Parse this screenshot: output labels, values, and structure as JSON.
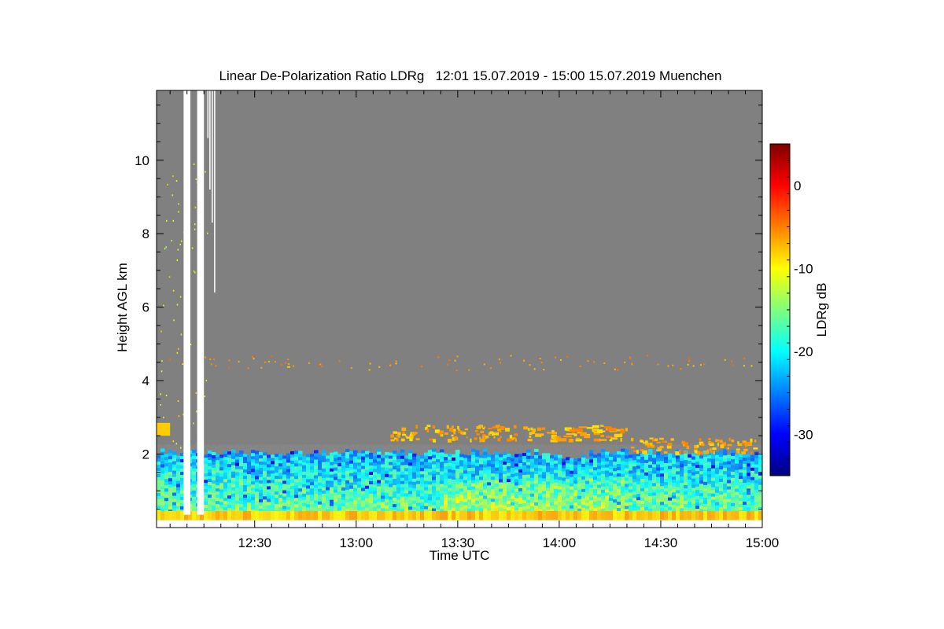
{
  "chart_data": {
    "type": "heatmap",
    "title": "Linear De-Polarization Ratio LDRg   12:01 15.07.2019 - 15:00 15.07.2019 Muenchen",
    "xlabel": "Time UTC",
    "ylabel": "Height AGL km",
    "colorbar_label": "LDRg dB",
    "x_range": [
      "12:01",
      "15:00"
    ],
    "xlim_minutes_utc": [
      721,
      900
    ],
    "x_ticks": [
      {
        "label": "12:30",
        "minutes": 750
      },
      {
        "label": "13:00",
        "minutes": 780
      },
      {
        "label": "13:30",
        "minutes": 810
      },
      {
        "label": "14:00",
        "minutes": 840
      },
      {
        "label": "14:30",
        "minutes": 870
      },
      {
        "label": "15:00",
        "minutes": 900
      }
    ],
    "y_ticks": [
      2,
      4,
      6,
      8,
      10
    ],
    "ylim_km": [
      0,
      11.9
    ],
    "colorbar_ticks": [
      0,
      -10,
      -20,
      -30
    ],
    "colorbar_range_db": [
      -35,
      5
    ],
    "colormap": [
      "#00007f",
      "#0000ff",
      "#007fff",
      "#00ffff",
      "#7fff7f",
      "#ffff00",
      "#ff7f00",
      "#ff0000",
      "#7f0000"
    ],
    "background_no_signal_color": "#808080",
    "missing_data_color": "#ffffff",
    "missing_data_intervals_minutes": [
      [
        729,
        731
      ],
      [
        733,
        735
      ]
    ],
    "grid": false,
    "features": {
      "boundary_layer_top_km": 2.0,
      "boundary_layer_ldr_db": [
        -22,
        -10
      ],
      "aerosol_layer_km": [
        2.4,
        2.8
      ],
      "aerosol_layer_ldr_db": -8
    }
  }
}
